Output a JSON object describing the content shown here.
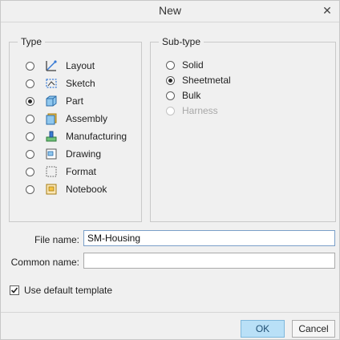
{
  "dialog": {
    "title": "New",
    "close_icon": "close-icon"
  },
  "type_group": {
    "title": "Type",
    "items": [
      {
        "label": "Layout",
        "icon": "layout-icon",
        "selected": false
      },
      {
        "label": "Sketch",
        "icon": "sketch-icon",
        "selected": false
      },
      {
        "label": "Part",
        "icon": "part-icon",
        "selected": true
      },
      {
        "label": "Assembly",
        "icon": "assembly-icon",
        "selected": false
      },
      {
        "label": "Manufacturing",
        "icon": "manufacturing-icon",
        "selected": false
      },
      {
        "label": "Drawing",
        "icon": "drawing-icon",
        "selected": false
      },
      {
        "label": "Format",
        "icon": "format-icon",
        "selected": false
      },
      {
        "label": "Notebook",
        "icon": "notebook-icon",
        "selected": false
      }
    ]
  },
  "subtype_group": {
    "title": "Sub-type",
    "items": [
      {
        "label": "Solid",
        "selected": false,
        "disabled": false
      },
      {
        "label": "Sheetmetal",
        "selected": true,
        "disabled": false
      },
      {
        "label": "Bulk",
        "selected": false,
        "disabled": false
      },
      {
        "label": "Harness",
        "selected": false,
        "disabled": true
      }
    ]
  },
  "form": {
    "file_name_label": "File name:",
    "file_name_value": "SM-Housing",
    "common_name_label": "Common name:",
    "common_name_value": ""
  },
  "options": {
    "use_default_template_label": "Use default template",
    "use_default_template_checked": true
  },
  "buttons": {
    "ok": "OK",
    "cancel": "Cancel"
  },
  "colors": {
    "ok_button_bg": "#b9e0f7",
    "icon_blue": "#3a7bd5"
  }
}
